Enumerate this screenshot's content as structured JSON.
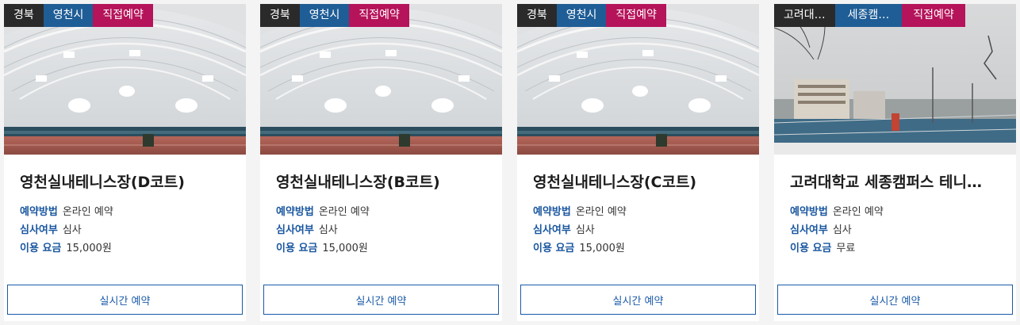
{
  "cards": [
    {
      "region": "경북",
      "city": "영천시",
      "booking_type": "직접예약",
      "image_icon": "indoor-tennis-hall",
      "title": "영천실내테니스장(D코트)",
      "method_label": "예약방법",
      "method_value": "온라인 예약",
      "review_label": "심사여부",
      "review_value": "심사",
      "fee_label": "이용 요금",
      "fee_value": "15,000원",
      "button_label": "실시간 예약"
    },
    {
      "region": "경북",
      "city": "영천시",
      "booking_type": "직접예약",
      "image_icon": "indoor-tennis-hall",
      "title": "영천실내테니스장(B코트)",
      "method_label": "예약방법",
      "method_value": "온라인 예약",
      "review_label": "심사여부",
      "review_value": "심사",
      "fee_label": "이용 요금",
      "fee_value": "15,000원",
      "button_label": "실시간 예약"
    },
    {
      "region": "경북",
      "city": "영천시",
      "booking_type": "직접예약",
      "image_icon": "indoor-tennis-hall",
      "title": "영천실내테니스장(C코트)",
      "method_label": "예약방법",
      "method_value": "온라인 예약",
      "review_label": "심사여부",
      "review_value": "심사",
      "fee_label": "이용 요금",
      "fee_value": "15,000원",
      "button_label": "실시간 예약"
    },
    {
      "region": "고려대…",
      "city": "세종캠…",
      "booking_type": "직접예약",
      "image_icon": "outdoor-tennis-court",
      "title": "고려대학교 세종캠퍼스 테니…",
      "method_label": "예약방법",
      "method_value": "온라인 예약",
      "review_label": "심사여부",
      "review_value": "심사",
      "fee_label": "이용 요금",
      "fee_value": "무료",
      "button_label": "실시간 예약"
    }
  ],
  "colors": {
    "region_tag": "#2a2a2a",
    "city_tag": "#1f5d96",
    "booking_tag": "#b5135a",
    "label_blue": "#1a57a0",
    "button_border": "#1a5aa8"
  }
}
